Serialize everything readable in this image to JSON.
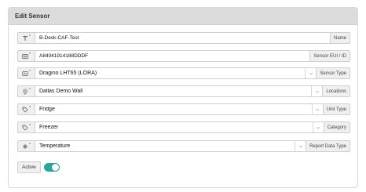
{
  "title": "Edit Sensor",
  "fields": [
    {
      "icon": "text-icon",
      "value": "B-Desk-CAF-Test",
      "label": "Name",
      "type": "text"
    },
    {
      "icon": "id-card-icon",
      "value": "A84041914188DDDF",
      "label": "Sensor EUI / ID",
      "type": "text"
    },
    {
      "icon": "sensor-type-icon",
      "value": "Dragino LHT65 (LORA)",
      "label": "Sensor Type",
      "type": "select"
    },
    {
      "icon": "map-pin-icon",
      "value": "Dallas Demo Wall",
      "label": "Locations",
      "type": "select"
    },
    {
      "icon": "tag-icon",
      "value": "Fridge",
      "label": "Unit Type",
      "type": "select"
    },
    {
      "icon": "tag-icon",
      "value": "Freezer",
      "label": "Category",
      "type": "select"
    },
    {
      "icon": "asterisk-icon",
      "value": "Temperature",
      "label": "Report Data Type",
      "type": "select"
    }
  ],
  "required_marker": "*",
  "active": {
    "label": "Active",
    "on": true
  },
  "colors": {
    "toggle_on": "#2aa79b",
    "header_bg": "#dcdcdc"
  }
}
